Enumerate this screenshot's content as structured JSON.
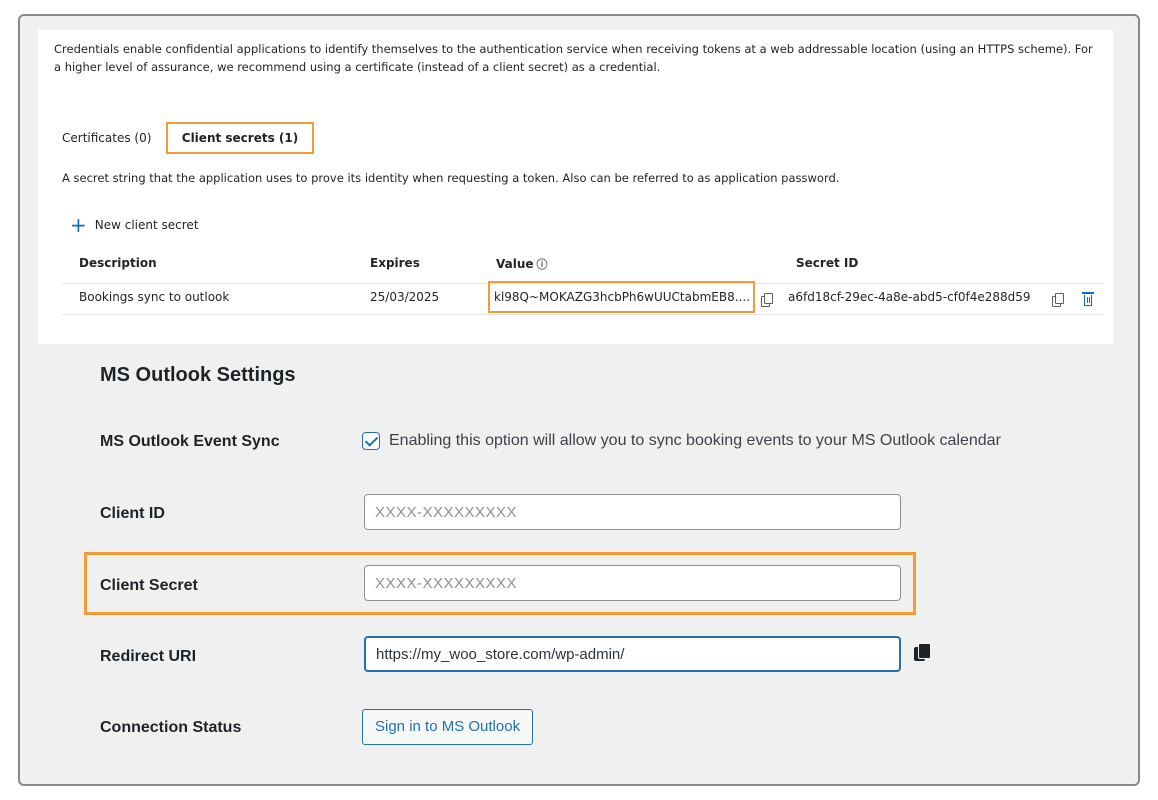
{
  "azure": {
    "intro_text": "Credentials enable confidential applications to identify themselves to the authentication service when receiving tokens at a web addressable location (using an HTTPS scheme). For a higher level of assurance, we recommend using a certificate (instead of a client secret) as a credential.",
    "tabs": [
      {
        "label": "Certificates (0)"
      },
      {
        "label": "Client secrets (1)",
        "active": true
      }
    ],
    "secret_description": "A secret string that the application uses to prove its identity when requesting a token. Also can be referred to as application password.",
    "new_secret_label": "New client secret",
    "table": {
      "headers": [
        "Description",
        "Expires",
        "Value",
        "Secret ID"
      ],
      "row": {
        "description": "Bookings sync to outlook",
        "expires": "25/03/2025",
        "value": "kl98Q~MOKAZG3hcbPh6wUUCtabmEB8....",
        "secret_id": "a6fd18cf-29ec-4a8e-abd5-cf0f4e288d59"
      }
    },
    "highlight_color": "#f29c38",
    "accent_color": "#0f6cbd"
  },
  "wp": {
    "title": "MS Outlook Settings",
    "event_sync": {
      "label": "MS Outlook Event Sync",
      "checked": true,
      "description": "Enabling this option will allow you to sync booking events to your MS Outlook calendar"
    },
    "client_id": {
      "label": "Client ID",
      "placeholder": "XXXX-XXXXXXXXX"
    },
    "client_secret": {
      "label": "Client Secret",
      "placeholder": "XXXX-XXXXXXXXX"
    },
    "redirect_uri": {
      "label": "Redirect URI",
      "value": "https://my_woo_store.com/wp-admin/"
    },
    "connection_status": {
      "label": "Connection Status",
      "button_label": "Sign in to MS Outlook"
    },
    "accent_color": "#2271b1"
  }
}
